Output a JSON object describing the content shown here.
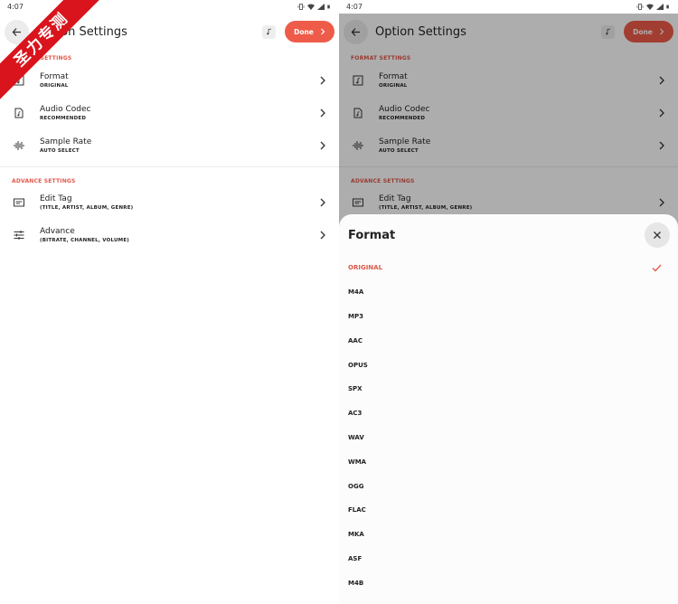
{
  "left": {
    "status_time": "4:07",
    "title": "Option Settings",
    "done_label": "Done",
    "format_section": "FORMAT SETTINGS",
    "format_section_visible": "SETTINGS",
    "advance_section": "ADVANCE SETTINGS",
    "rows": [
      {
        "title": "Format",
        "sub": "ORIGINAL",
        "icon": "music-file-icon"
      },
      {
        "title": "Audio Codec",
        "sub": "RECOMMENDED",
        "icon": "audio-file-icon"
      },
      {
        "title": "Sample Rate",
        "sub": "AUTO SELECT",
        "icon": "waveform-icon"
      }
    ],
    "advance_rows": [
      {
        "title": "Edit Tag",
        "sub": "(TITLE, ARTIST, ALBUM, GENRE)",
        "icon": "tag-icon"
      },
      {
        "title": "Advance",
        "sub": "(BITRATE, CHANNEL, VOLUME)",
        "icon": "sliders-icon"
      }
    ]
  },
  "right": {
    "status_time": "4:07",
    "title": "Option Settings",
    "done_label": "Done",
    "format_section": "FORMAT SETTINGS",
    "advance_section": "ADVANCE SETTINGS",
    "rows": [
      {
        "title": "Format",
        "sub": "ORIGINAL"
      },
      {
        "title": "Audio Codec",
        "sub": "RECOMMENDED"
      },
      {
        "title": "Sample Rate",
        "sub": "AUTO SELECT"
      }
    ],
    "advance_rows": [
      {
        "title": "Edit Tag",
        "sub": "(TITLE, ARTIST, ALBUM, GENRE)"
      }
    ],
    "sheet": {
      "title": "Format",
      "options": [
        "ORIGINAL",
        "M4A",
        "MP3",
        "AAC",
        "OPUS",
        "SPX",
        "AC3",
        "WAV",
        "WMA",
        "OGG",
        "FLAC",
        "MKA",
        "ASF",
        "M4B"
      ],
      "selected": "ORIGINAL"
    }
  },
  "watermark": "圣力专测",
  "colors": {
    "accent": "#ef5b49",
    "section": "#e0584a"
  }
}
